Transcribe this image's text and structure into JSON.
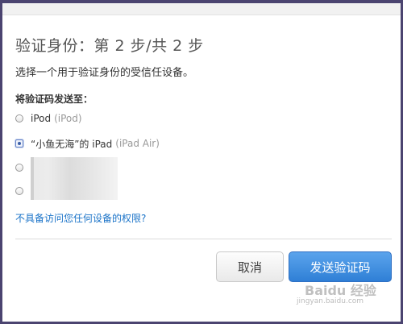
{
  "dialog": {
    "title": "验证身份：第 2 步/共 2 步",
    "subtitle": "选择一个用于验证身份的受信任设备。",
    "send_to_label": "将验证码发送至：",
    "options": [
      {
        "name": "iPod",
        "model": "(iPod)",
        "checked": false
      },
      {
        "name": "“小鱼无海”的 iPad",
        "model": "(iPad Air)",
        "checked": true
      },
      {
        "name": "",
        "model": "",
        "checked": false
      },
      {
        "name": "",
        "model": "",
        "checked": false
      }
    ],
    "no_access_link": "不具备访问您任何设备的权限?",
    "cancel_label": "取消",
    "send_label": "发送验证码"
  },
  "watermark": {
    "logo": "Baidu 经验",
    "url": "jingyan.baidu.com"
  }
}
